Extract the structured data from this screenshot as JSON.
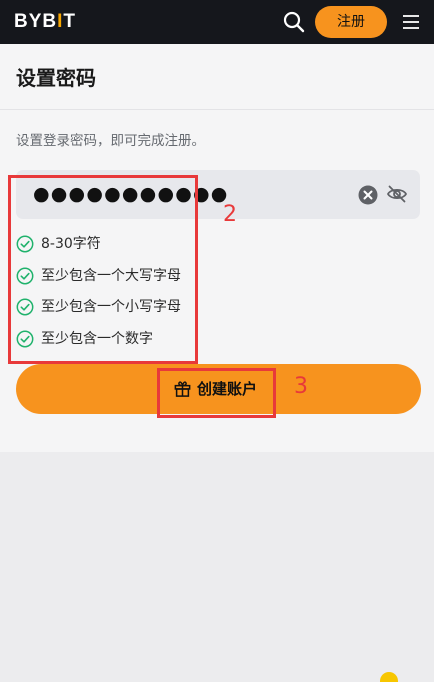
{
  "header": {
    "logo_text_a": "BYB",
    "logo_text_bar": "I",
    "logo_text_b": "T",
    "search_icon": "search-icon",
    "signup_label": "注册",
    "menu_icon": "hamburger-menu-icon"
  },
  "page": {
    "title": "设置密码",
    "instruction": "设置登录密码，即可完成注册。"
  },
  "password_field": {
    "value_masked": "●●●●●●●●●●●",
    "clear_icon": "clear-icon",
    "visibility_icon": "eye-off-icon"
  },
  "requirements": [
    {
      "text": "8-30字符",
      "met": true
    },
    {
      "text": "至少包含一个大写字母",
      "met": true
    },
    {
      "text": "至少包含一个小写字母",
      "met": true
    },
    {
      "text": "至少包含一个数字",
      "met": true
    }
  ],
  "create_button": {
    "icon": "gift-icon",
    "label": "创建账户"
  },
  "annotations": [
    {
      "number": "2"
    },
    {
      "number": "3"
    }
  ],
  "colors": {
    "brand_orange": "#f7931e",
    "header_bg": "#15171c",
    "check_green": "#20b26c",
    "annotation_red": "#e8393a"
  }
}
